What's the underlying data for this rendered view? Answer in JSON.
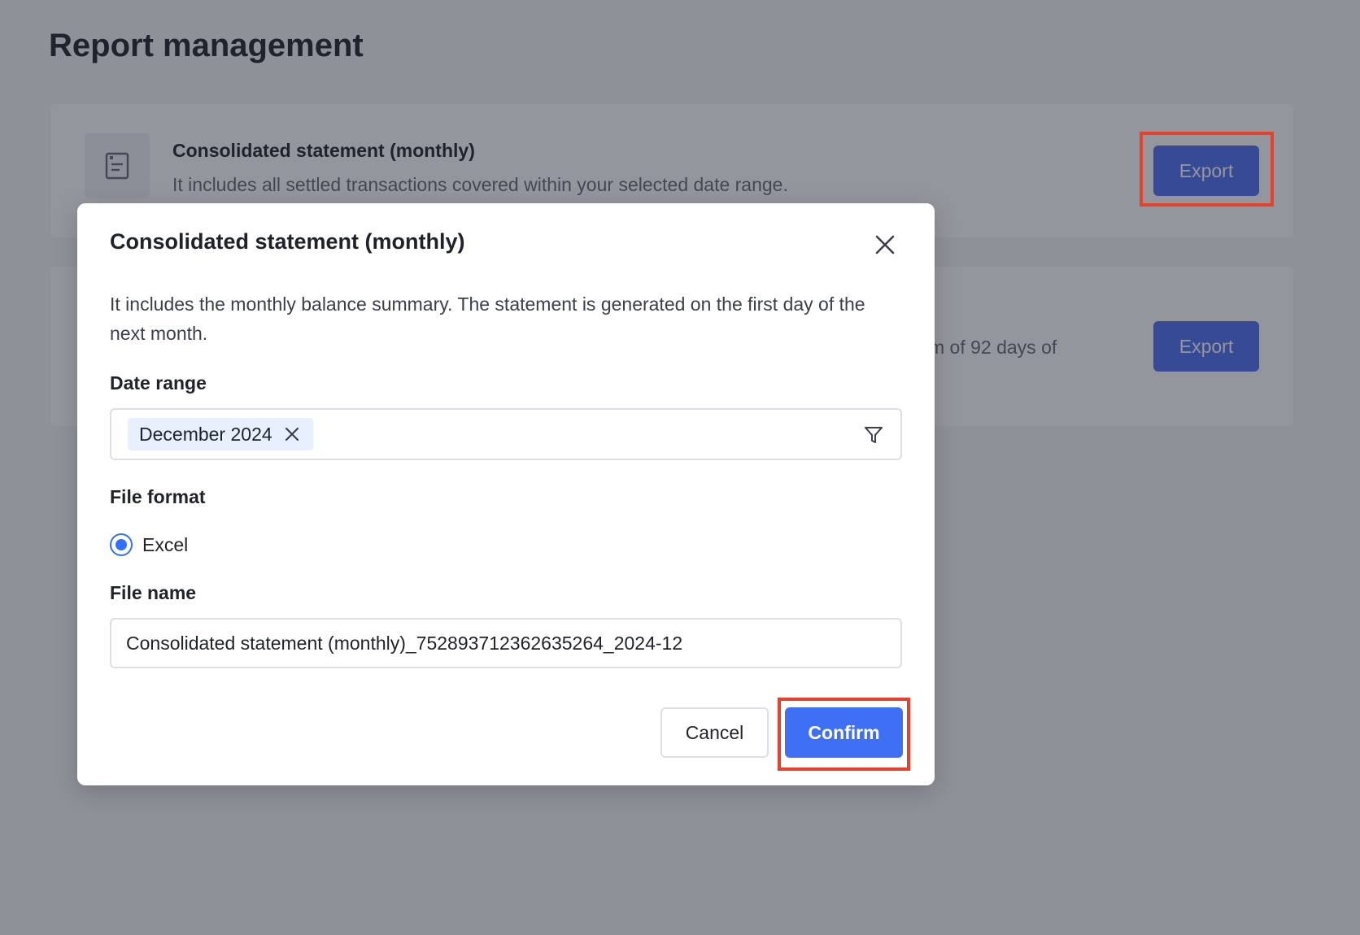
{
  "page": {
    "title": "Report management"
  },
  "cards": [
    {
      "title": "Consolidated statement (monthly)",
      "description": "It includes all settled transactions covered within your selected date range.",
      "export_label": "Export",
      "icon": "document-icon"
    },
    {
      "description_fragment": "m of 92 days of",
      "export_label": "Export"
    }
  ],
  "modal": {
    "title": "Consolidated statement (monthly)",
    "description": "It includes the monthly balance summary. The statement is generated on the first day of the next month.",
    "date_range_label": "Date range",
    "date_range_tag": "December 2024",
    "file_format_label": "File format",
    "file_format_option": "Excel",
    "file_name_label": "File name",
    "file_name_value": "Consolidated statement (monthly)_752893712362635264_2024-12",
    "cancel_label": "Cancel",
    "confirm_label": "Confirm"
  },
  "colors": {
    "primary": "#3e6ff4",
    "highlight": "#e8402a",
    "tag_bg": "#e8f0ff"
  }
}
